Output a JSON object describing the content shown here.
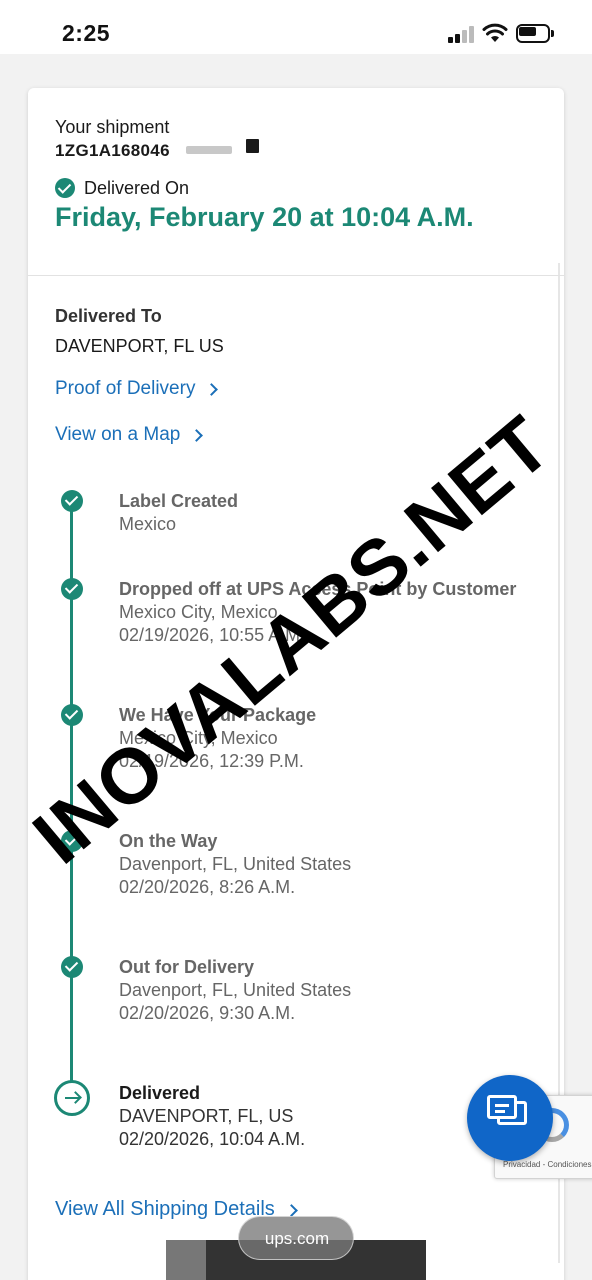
{
  "status_bar": {
    "time": "2:25"
  },
  "shipment": {
    "label": "Your shipment",
    "tracking_number": "1ZG1A168046",
    "status_label": "Delivered On",
    "delivered_date": "Friday, February 20 at 10:04 A.M."
  },
  "delivered_to": {
    "heading": "Delivered To",
    "value": "DAVENPORT, FL US"
  },
  "links": {
    "proof_of_delivery": "Proof of Delivery",
    "view_on_map": "View on a Map",
    "view_all": "View All Shipping Details"
  },
  "timeline": [
    {
      "title": "Label Created",
      "lines": [
        "Mexico"
      ]
    },
    {
      "title": "Dropped off at UPS Access Point by Customer",
      "lines": [
        "Mexico City, Mexico",
        "02/19/2026, 10:55 A.M."
      ]
    },
    {
      "title": "We Have Your Package",
      "lines": [
        "Mexico City, Mexico",
        "02/19/2026, 12:39 P.M."
      ]
    },
    {
      "title": "On the Way",
      "lines": [
        "Davenport, FL, United States",
        "02/20/2026, 8:26 A.M."
      ]
    },
    {
      "title": "Out for Delivery",
      "lines": [
        "Davenport, FL, United States",
        "02/20/2026, 9:30 A.M."
      ]
    },
    {
      "title": "Delivered",
      "lines": [
        "DAVENPORT, FL, US",
        "02/20/2026, 10:04 A.M."
      ]
    }
  ],
  "watermark": "INOVALABS.NET",
  "recaptcha": {
    "text": "Privacidad - Condiciones"
  },
  "browser": {
    "url": "ups.com"
  },
  "colors": {
    "accent_green": "#1c8875",
    "link_blue": "#1b6fb8",
    "chat_blue": "#1066c8"
  },
  "icons": [
    "signal-icon",
    "wifi-icon",
    "battery-icon",
    "check-circle-icon",
    "chevron-right-icon",
    "arrow-right-circle-icon",
    "chat-icon",
    "recaptcha-icon"
  ]
}
